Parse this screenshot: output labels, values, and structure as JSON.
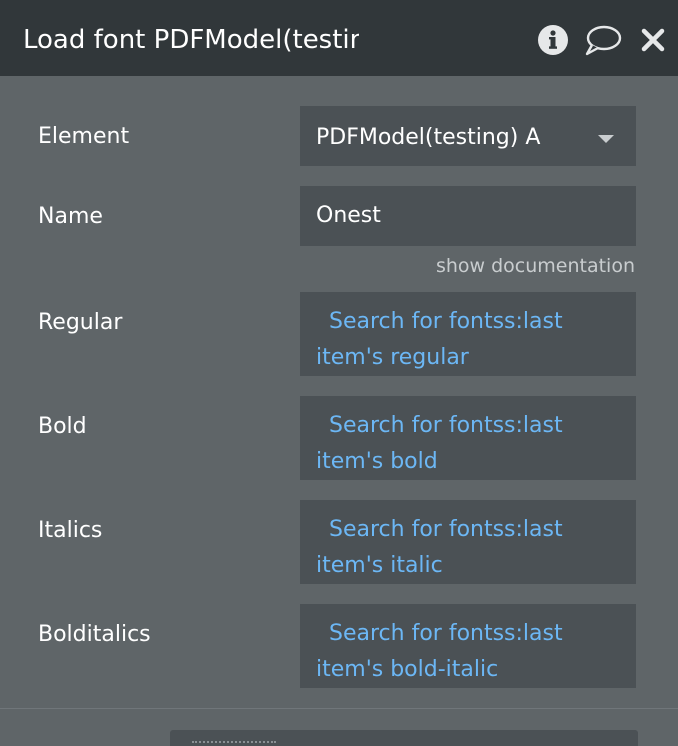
{
  "header": {
    "title": "Load font PDFModel(testing) A",
    "icons": [
      "info-icon",
      "comment-icon",
      "close-icon"
    ]
  },
  "fields": {
    "element": {
      "label": "Element",
      "value": "PDFModel(testing) A"
    },
    "name": {
      "label": "Name",
      "value": "Onest"
    },
    "show_documentation": "show documentation",
    "regular": {
      "label": "Regular",
      "expression": "Search for fontss:last item's regular"
    },
    "bold": {
      "label": "Bold",
      "expression": "Search for fontss:last item's bold"
    },
    "italics": {
      "label": "Italics",
      "expression": "Search for fontss:last item's italic"
    },
    "bolditalics": {
      "label": "Bolditalics",
      "expression": "Search for fontss:last item's bold-italic"
    }
  },
  "colors": {
    "header_bg": "#31373a",
    "panel_bg": "#5f6568",
    "field_bg": "#4b5155",
    "dynamic_text": "#6cb7f5"
  }
}
